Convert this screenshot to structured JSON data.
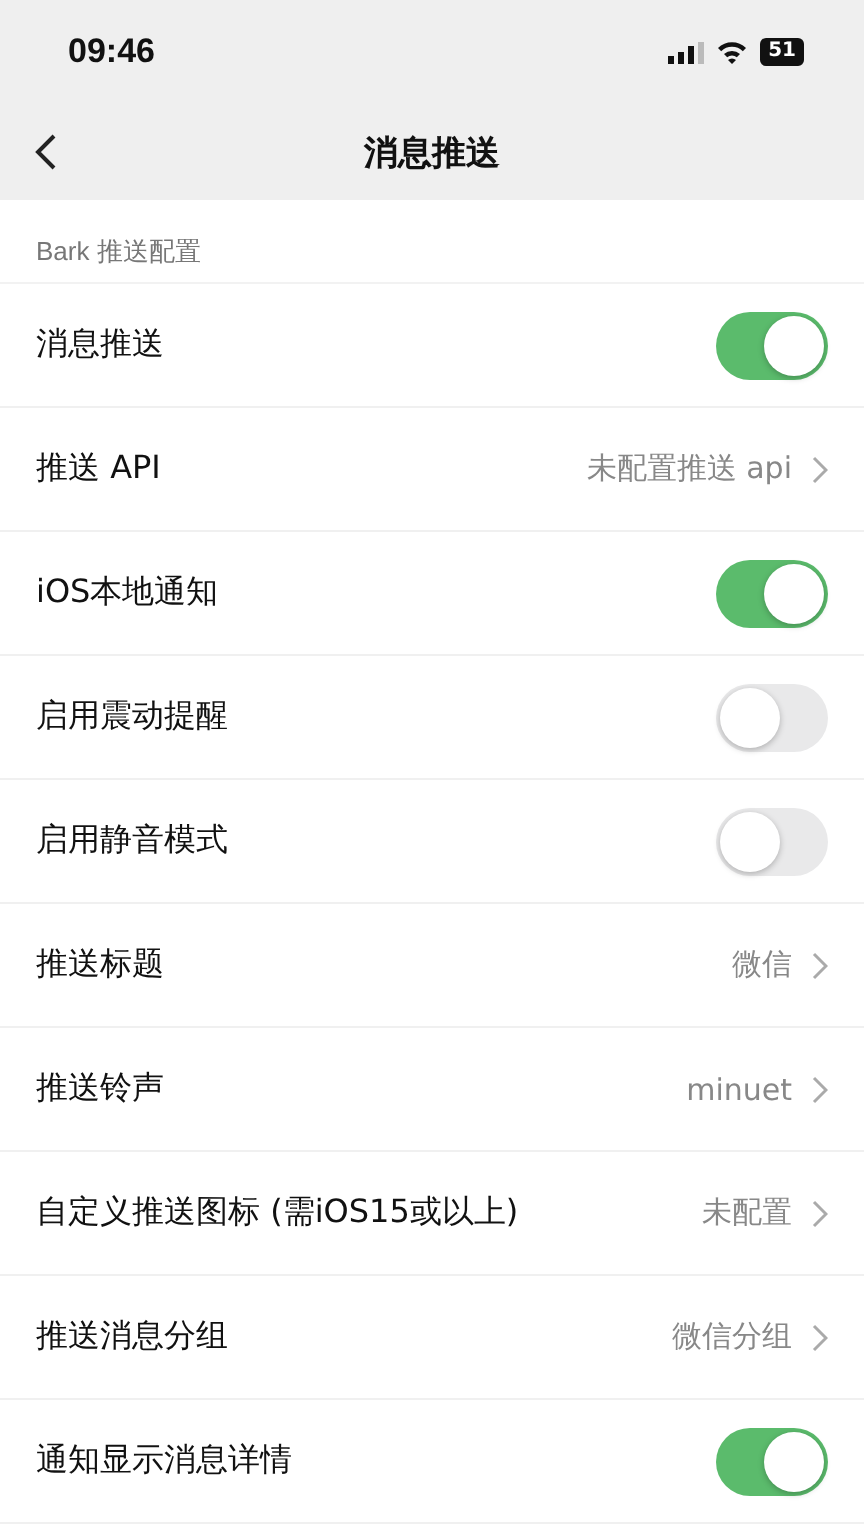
{
  "status_bar": {
    "time": "09:46",
    "battery": "51"
  },
  "nav": {
    "title": "消息推送"
  },
  "section": {
    "title": "Bark 推送配置"
  },
  "rows": [
    {
      "kind": "toggle",
      "label": "消息推送",
      "on": true
    },
    {
      "kind": "link",
      "label": "推送 API",
      "value": "未配置推送 api"
    },
    {
      "kind": "toggle",
      "label": "iOS本地通知",
      "on": true
    },
    {
      "kind": "toggle",
      "label": "启用震动提醒",
      "on": false
    },
    {
      "kind": "toggle",
      "label": "启用静音模式",
      "on": false
    },
    {
      "kind": "link",
      "label": "推送标题",
      "value": "微信"
    },
    {
      "kind": "link",
      "label": "推送铃声",
      "value": "minuet"
    },
    {
      "kind": "link",
      "label": "自定义推送图标 (需iOS15或以上)",
      "value": "未配置"
    },
    {
      "kind": "link",
      "label": "推送消息分组",
      "value": "微信分组"
    },
    {
      "kind": "toggle",
      "label": "通知显示消息详情",
      "on": true
    }
  ]
}
